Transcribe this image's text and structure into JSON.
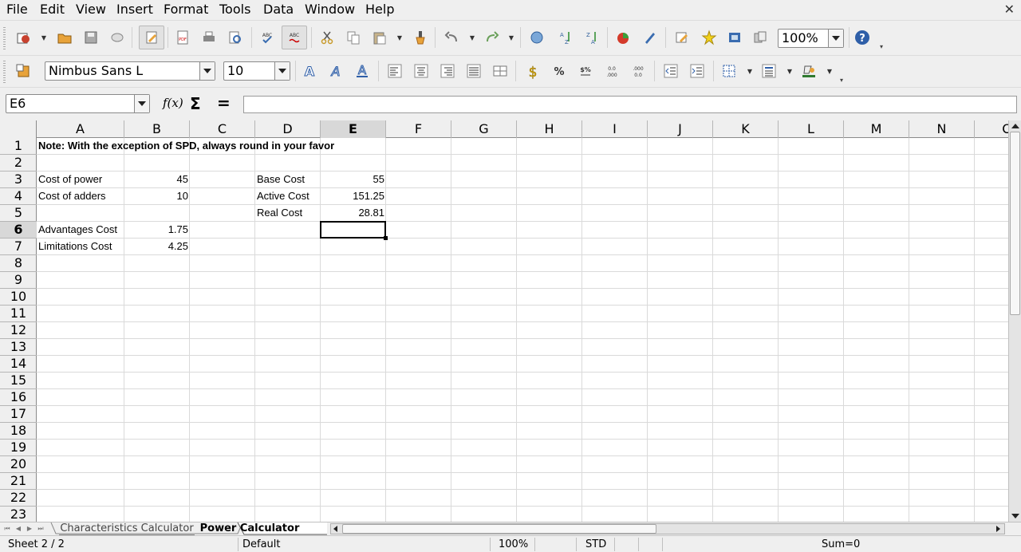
{
  "menu": [
    "File",
    "Edit",
    "View",
    "Insert",
    "Format",
    "Tools",
    "Data",
    "Window",
    "Help"
  ],
  "toolbar": {
    "zoom": "100%",
    "font_name": "Nimbus Sans L",
    "font_size": "10"
  },
  "formula": {
    "cell_ref": "E6",
    "content": ""
  },
  "columns": [
    "A",
    "B",
    "C",
    "D",
    "E",
    "F",
    "G",
    "H",
    "I",
    "J",
    "K",
    "L",
    "M",
    "N",
    "O"
  ],
  "active_column": "E",
  "rows": [
    "1",
    "2",
    "3",
    "4",
    "5",
    "6",
    "7",
    "8",
    "9",
    "10",
    "11",
    "12",
    "13",
    "14",
    "15",
    "16",
    "17",
    "18",
    "19",
    "20",
    "21",
    "22",
    "23"
  ],
  "active_row": "6",
  "cells": {
    "A1": "Note: With the exception of SPD, always round in your favor",
    "A3": "Cost of power",
    "B3": "45",
    "A4": "Cost of adders",
    "B4": "10",
    "A6": "Advantages Cost",
    "B6": "1.75",
    "A7": "Limitations Cost",
    "B7": "4.25",
    "D3": "Base Cost",
    "E3": "55",
    "D4": "Active Cost",
    "E4": "151.25",
    "D5": "Real Cost",
    "E5": "28.81"
  },
  "sheets": [
    {
      "name": "Characteristics Calculator",
      "active": false
    },
    {
      "name": "Power Calculator",
      "active": true
    }
  ],
  "status": {
    "sheet": "Sheet 2 / 2",
    "style": "Default",
    "zoom": "100%",
    "mode": "STD",
    "sum": "Sum=0"
  }
}
